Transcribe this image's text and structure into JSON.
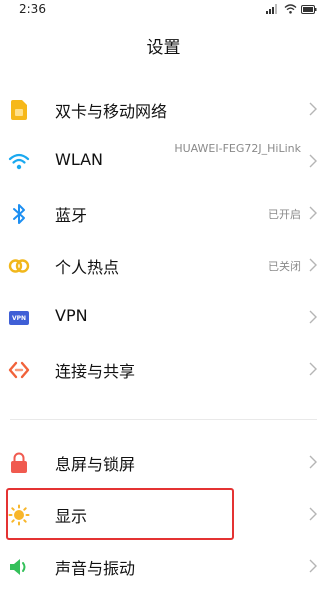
{
  "status_bar": {
    "time": "2:36",
    "icons": [
      "signal-icon",
      "wifi-icon",
      "battery-icon"
    ]
  },
  "header": {
    "title": "设置"
  },
  "settings": {
    "items": [
      {
        "label": "双卡与移动网络",
        "icon": "sim-card-icon",
        "value": ""
      },
      {
        "label": "WLAN",
        "icon": "wifi-icon",
        "value": "HUAWEI-FEG72J_HiLink"
      },
      {
        "label": "蓝牙",
        "icon": "bluetooth-icon",
        "value": "已开启"
      },
      {
        "label": "个人热点",
        "icon": "hotspot-icon",
        "value": "已关闭"
      },
      {
        "label": "VPN",
        "icon": "vpn-icon",
        "value": "",
        "icon_text": "VPN"
      },
      {
        "label": "连接与共享",
        "icon": "connection-share-icon",
        "value": ""
      },
      {
        "label": "息屏与锁屏",
        "icon": "lock-icon",
        "value": ""
      },
      {
        "label": "显示",
        "icon": "sun-icon",
        "value": ""
      },
      {
        "label": "声音与振动",
        "icon": "speaker-icon",
        "value": ""
      }
    ]
  },
  "colors": {
    "sim": "#f6b81a",
    "wifi": "#1aa9f0",
    "bluetooth": "#1d8ff2",
    "hotspot": "#f1b71b",
    "vpn": "#3f5fd6",
    "connection": "#f1623a",
    "lock": "#f05a4f",
    "sun": "#f8b62a",
    "speaker": "#34c05a",
    "highlight": "#e43333"
  }
}
